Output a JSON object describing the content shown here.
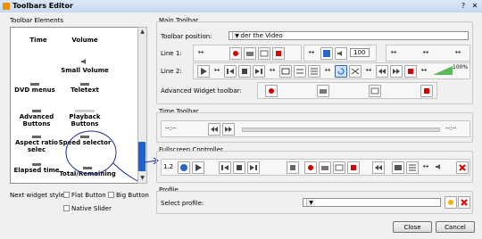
{
  "window": {
    "title": "Toolbars Editor"
  },
  "left": {
    "group_title": "Toolbar Elements",
    "elements": [
      {
        "label": "Time"
      },
      {
        "label": "Volume"
      },
      {
        "label": "Small Volume"
      },
      {
        "label": "DVD menus"
      },
      {
        "label": "Teletext"
      },
      {
        "label": "Advanced Buttons"
      },
      {
        "label": "Playback Buttons"
      },
      {
        "label": "Aspect ratio selec"
      },
      {
        "label": "Speed selector"
      },
      {
        "label": "Elapsed time"
      },
      {
        "label": "Total/Remaining"
      }
    ],
    "widget_style_label": "Next widget style:",
    "flat_button": "Flat Button",
    "big_button": "Big Button",
    "native_slider": "Native Slider"
  },
  "main": {
    "group_title": "Main Toolbar",
    "position_label": "Toolbar position:",
    "position_value": "Under the Video",
    "line1_label": "Line 1:",
    "line2_label": "Line 2:",
    "advanced_label": "Advanced Widget toolbar:",
    "volume_value": "100",
    "volume_percent": "100%"
  },
  "time_toolbar": {
    "group_title": "Time Toolbar",
    "time_placeholder": "--:--"
  },
  "fullscreen": {
    "group_title": "Fullscreen Controller",
    "speed_value": "1.2"
  },
  "profile": {
    "group_title": "Profile",
    "select_label": "Select profile:",
    "select_value": ""
  },
  "footer": {
    "close": "Close",
    "cancel": "Cancel"
  },
  "colors": {
    "accent": "#1f5fd0",
    "record": "#d80000",
    "titlebar": "#c6d9f0"
  }
}
